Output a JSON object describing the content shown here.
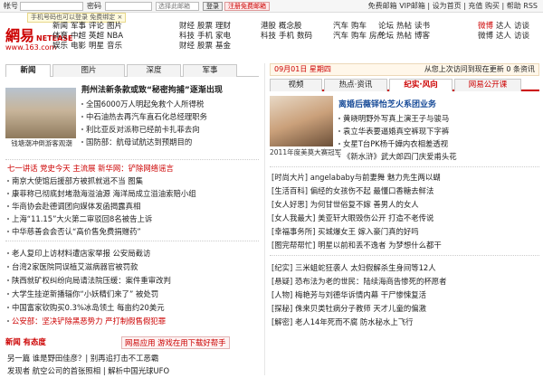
{
  "login": {
    "account_label": "帐号",
    "password_label": "密码",
    "select_value": "选择此邮箱",
    "login_button": "登录",
    "register": "注册免费邮箱",
    "right": "免费邮箱 VIP邮箱 | 设为首页 | 充值 购买 | 帮助 RSS",
    "hint": "手机号码也可以登录 免费绑定 ×"
  },
  "logo": {
    "cn": "網易",
    "en": "NETEASE",
    "url": "www.163.com"
  },
  "nav": [
    [
      "新闻",
      "军事",
      "评论",
      "图片"
    ],
    [
      "体育",
      "中超",
      "英超",
      "NBA"
    ],
    [
      "娱乐",
      "电影",
      "明星",
      "音乐"
    ],
    [
      "财经",
      "股票",
      "基金"
    ],
    [
      "科技",
      "手机",
      "数码"
    ],
    [
      "汽车",
      "购车",
      "房产"
    ],
    [
      "论坛",
      "热帖",
      "博客"
    ],
    [
      "微博",
      "达人",
      "访谈"
    ]
  ],
  "nav2": [
    [
      "财经",
      "股票",
      "理财"
    ],
    [
      "科技",
      "手机",
      "家电"
    ],
    [
      "港股",
      "概念股"
    ],
    [
      "汽车",
      "购车"
    ],
    [
      "论坛",
      "热帖",
      "读书"
    ],
    [
      "微博",
      "达人",
      "访谈"
    ]
  ],
  "left_tabs": [
    "新闻",
    "图片",
    "深度",
    "军事"
  ],
  "left": {
    "headline": "荆州法新条款或致“秘密拘捕”逐渐出现",
    "photo_caption": "钱塘潮冲倒游客观潮",
    "news1": [
      "全国6000万人明起免救个人所得税",
      "中石油热去再汽车直石化总经理职务",
      "利比亚反对派称已经前卡扎菲去向",
      "国防部：航母试航达到预期目的"
    ],
    "hot": "七一讲话  党史今天  主流展  新华网：铲除网络谣言",
    "news2": [
      "南京大使馆后援部方被抓就逃不当  图集",
      "康菲称已彻底封堵渤海溢油源  海洋局成立溢油索赔小组",
      "华商协会赴德调团向媒体发函揭露真相",
      "上海“11.15”大火第二审驳回8名被告上诉",
      "中华慈善会会否认“高价售免费捐赠药”"
    ],
    "news3": [
      "老人复印上访材料遭店家举报  公安局截访",
      "台湾2家医院同误植艾滋病器官被罚款",
      "陕西就矿权纠纷向局请法院压缓：案件重审改判",
      "大学生挂逆新播辐你“小妖精们来了”  被处罚",
      "中国富家钦购买0.3%冰岛领土  每亩约20美元",
      "公安部：坚决铲除黑恶势力  严打制假售假犯罪"
    ],
    "app_label": "新闻  有态度",
    "app_right": "网易应用  游戏在用下载好帮手",
    "bottom": [
      "另一篇  谁是野田佳彦？| 别再追打击不工恶霸",
      "发现者  航空公司的首张照相 | 解析中国光球UFO"
    ]
  },
  "right": {
    "date": "09月01日 星期四",
    "date_right": "从您上次访问到现在更新 0 条资讯",
    "tabs": [
      "视频",
      "热点·资讯",
      "纪实·风向",
      "网易公开课"
    ],
    "feature_title": "离婚后薇铎怡芝火系团业务",
    "feature": [
      "黄晓明野外写真上演王子与骏马",
      "袁立华表要逼婚真空裤现下字裤",
      "女星T台PK杨千嬅内衣相差透视",
      "《新水浒》武大郎四门庆爱甫头花"
    ],
    "photo_caption": "2011年度美莫大赛冠军",
    "list1": [
      "[时尚大片] angelababy与前妻舞  魅力先生两以蝴",
      "[生活百科] 偏经的女孩伤不起  最懂口香糖去鲜法",
      "[女人好思] 为何甘世俗复不嫁  善男人的女人",
      "[女人我最大] 美亚轩大眼毁伤公开  打造不老传说",
      "[幸福事务所] 买城爆女王  嫁入豪门真的好吗",
      "[图完帮帮忙] 明星以前和丢不逸者  为梦想什么都干"
    ],
    "list2": [
      "[纪实]  三米蛆蛇狂袭人  太妇假解杀生身间等12人",
      "[悬疑]  恐布法为老的世民：陆续海商告惨死的杯愿者",
      "[人物]  梅艳芳与刘德华诉情内幕  干尸惨悚复活",
      "[探秘]  侏来贝类牡病分子教师  天才儿童的偏激",
      "[解密]  老人14年死而不腐  防水秘水上飞行"
    ]
  }
}
